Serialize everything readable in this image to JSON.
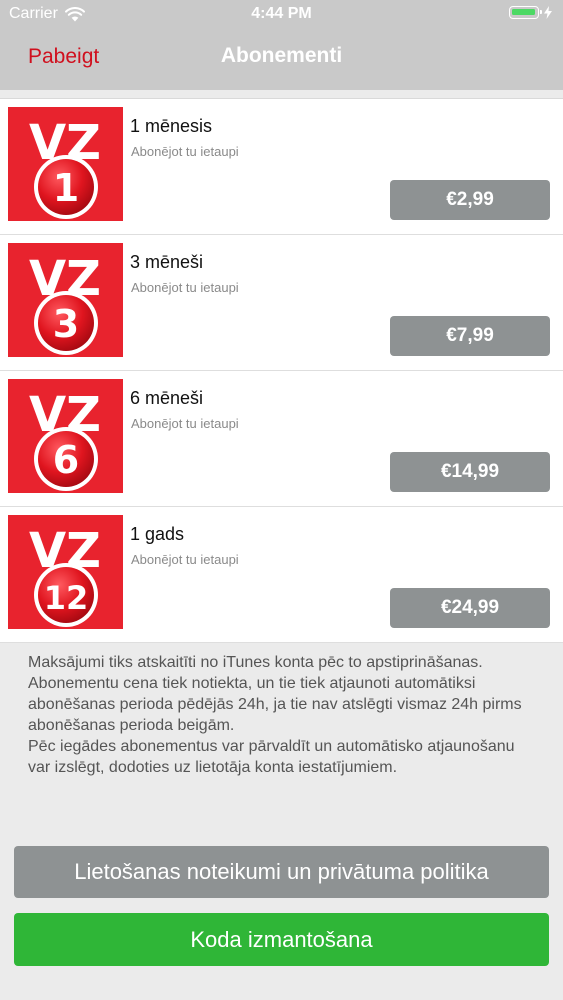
{
  "status_bar": {
    "carrier": "Carrier",
    "time": "4:44 PM",
    "battery_level": 1.0,
    "battery_color": "#4cd964"
  },
  "nav": {
    "back_label": "Pabeigt",
    "title": "Abonementi",
    "back_color": "#d0101e"
  },
  "subscriptions": [
    {
      "badge": "1",
      "title": "1 mēnesis",
      "subtitle": "Abonējot tu ietaupi",
      "price": "€2,99"
    },
    {
      "badge": "3",
      "title": "3 mēneši",
      "subtitle": "Abonējot tu ietaupi",
      "price": "€7,99"
    },
    {
      "badge": "6",
      "title": "6 mēneši",
      "subtitle": "Abonējot tu ietaupi",
      "price": "€14,99"
    },
    {
      "badge": "12",
      "title": "1 gads",
      "subtitle": "Abonējot tu ietaupi",
      "price": "€24,99"
    }
  ],
  "logo": {
    "brand_text": "VZ",
    "brand_color": "#e8232e"
  },
  "disclaimer": {
    "paragraph1": "Maksājumi tiks atskaitīti no iTunes konta pēc to apstiprināšanas.",
    "paragraph2": "Abonementu cena tiek notiekta, un tie tiek atjaunoti automātiksi abonēšanas perioda pēdējās 24h, ja tie nav atslēgti vismaz 24h pirms abonēšanas perioda beigām.",
    "paragraph3": "Pēc iegādes abonementus var pārvaldīt un automātisko atjaunošanu var izslēgt, dodoties uz lietotāja konta iestatījumiem."
  },
  "buttons": {
    "terms_label": "Lietošanas noteikumi un privātuma politika",
    "code_label": "Koda izmantošana",
    "code_color": "#2fb637",
    "price_color": "#8e9293"
  }
}
